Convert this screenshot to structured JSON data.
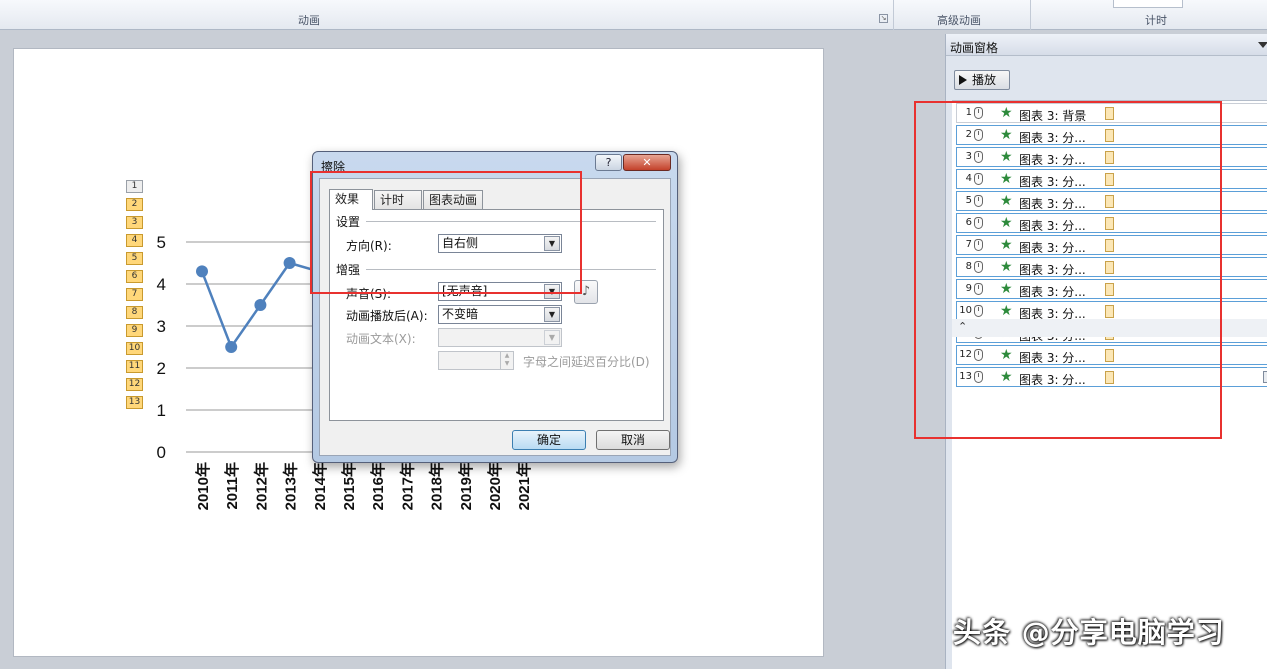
{
  "ribbon": {
    "groups": [
      {
        "label": "动画"
      },
      {
        "label": "高级动画"
      },
      {
        "label": "计时"
      }
    ]
  },
  "slide": {
    "anim_tags": [
      "1",
      "2",
      "3",
      "4",
      "5",
      "6",
      "7",
      "8",
      "9",
      "10",
      "11",
      "12",
      "13"
    ],
    "chart_data": {
      "type": "line",
      "title": "",
      "xlabel": "",
      "ylabel": "",
      "categories": [
        "2010年",
        "2011年",
        "2012年",
        "2013年",
        "2014年",
        "2015年",
        "2016年",
        "2017年",
        "2018年",
        "2019年",
        "2020年",
        "2021年"
      ],
      "visible_values": [
        4.3,
        2.5,
        3.5,
        4.5,
        4.3
      ],
      "y_ticks": [
        "0",
        "1",
        "2",
        "3",
        "4",
        "5"
      ],
      "ylim": [
        0,
        5
      ],
      "grid": true,
      "line_color": "#4f81bd"
    }
  },
  "dialog": {
    "title": "擦除",
    "help_label": "?",
    "close_label": "✕",
    "tabs": [
      "效果",
      "计时",
      "图表动画"
    ],
    "settings_label": "设置",
    "direction_label": "方向(R):",
    "direction_value": "自右侧",
    "enhance_label": "增强",
    "sound_label": "声音(S):",
    "sound_value": "[无声音]",
    "after_anim_label": "动画播放后(A):",
    "after_anim_value": "不变暗",
    "anim_text_label": "动画文本(X):",
    "anim_text_value": "",
    "delay_label": "字母之间延迟百分比(D)",
    "ok_label": "确定",
    "cancel_label": "取消"
  },
  "pane": {
    "title": "动画窗格",
    "play_label": "播放",
    "items": [
      {
        "num": "1",
        "name": "图表 3: 背景"
      },
      {
        "num": "2",
        "name": "图表 3: 分..."
      },
      {
        "num": "3",
        "name": "图表 3: 分..."
      },
      {
        "num": "4",
        "name": "图表 3: 分..."
      },
      {
        "num": "5",
        "name": "图表 3: 分..."
      },
      {
        "num": "6",
        "name": "图表 3: 分..."
      },
      {
        "num": "7",
        "name": "图表 3: 分..."
      },
      {
        "num": "8",
        "name": "图表 3: 分..."
      },
      {
        "num": "9",
        "name": "图表 3: 分..."
      },
      {
        "num": "10",
        "name": "图表 3: 分..."
      },
      {
        "num": "11",
        "name": "图表 3: 分..."
      },
      {
        "num": "12",
        "name": "图表 3: 分..."
      },
      {
        "num": "13",
        "name": "图表 3: 分..."
      }
    ],
    "expand_icon": "double-chevron-up-icon"
  },
  "annotation_color": "#e8312f",
  "watermark": "头条 @分享电脑学习"
}
